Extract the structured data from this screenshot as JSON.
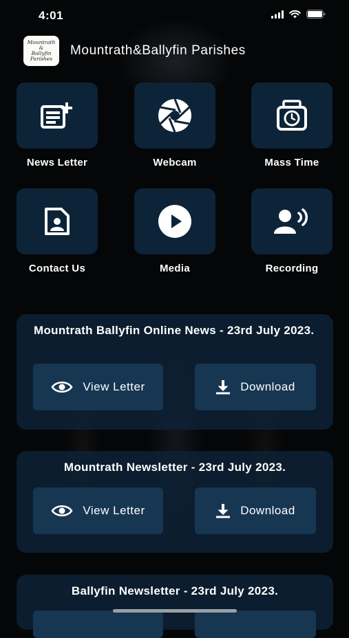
{
  "status_bar": {
    "time": "4:01"
  },
  "header": {
    "logo_text": [
      "Mountrath",
      "&",
      "Ballyfin",
      "Parishes"
    ],
    "title": "Mountrath&Ballyfin Parishes"
  },
  "tiles": [
    {
      "label": "News Letter",
      "icon": "newsletter-add-icon"
    },
    {
      "label": "Webcam",
      "icon": "camera-aperture-icon"
    },
    {
      "label": "Mass Time",
      "icon": "clock-icon"
    },
    {
      "label": "Contact Us",
      "icon": "contact-card-icon"
    },
    {
      "label": "Media",
      "icon": "play-circle-icon"
    },
    {
      "label": "Recording",
      "icon": "person-speaking-icon"
    }
  ],
  "newsletters": [
    {
      "title": "Mountrath Ballyfin Online News - 23rd July 2023.",
      "view_label": "View Letter",
      "download_label": "Download"
    },
    {
      "title": "Mountrath Newsletter - 23rd July 2023.",
      "view_label": "View Letter",
      "download_label": "Download"
    },
    {
      "title": "Ballyfin Newsletter - 23rd July 2023."
    }
  ],
  "colors": {
    "tile_bg": "#0d2338",
    "button_bg": "#173652",
    "page_bg": "#050607"
  }
}
